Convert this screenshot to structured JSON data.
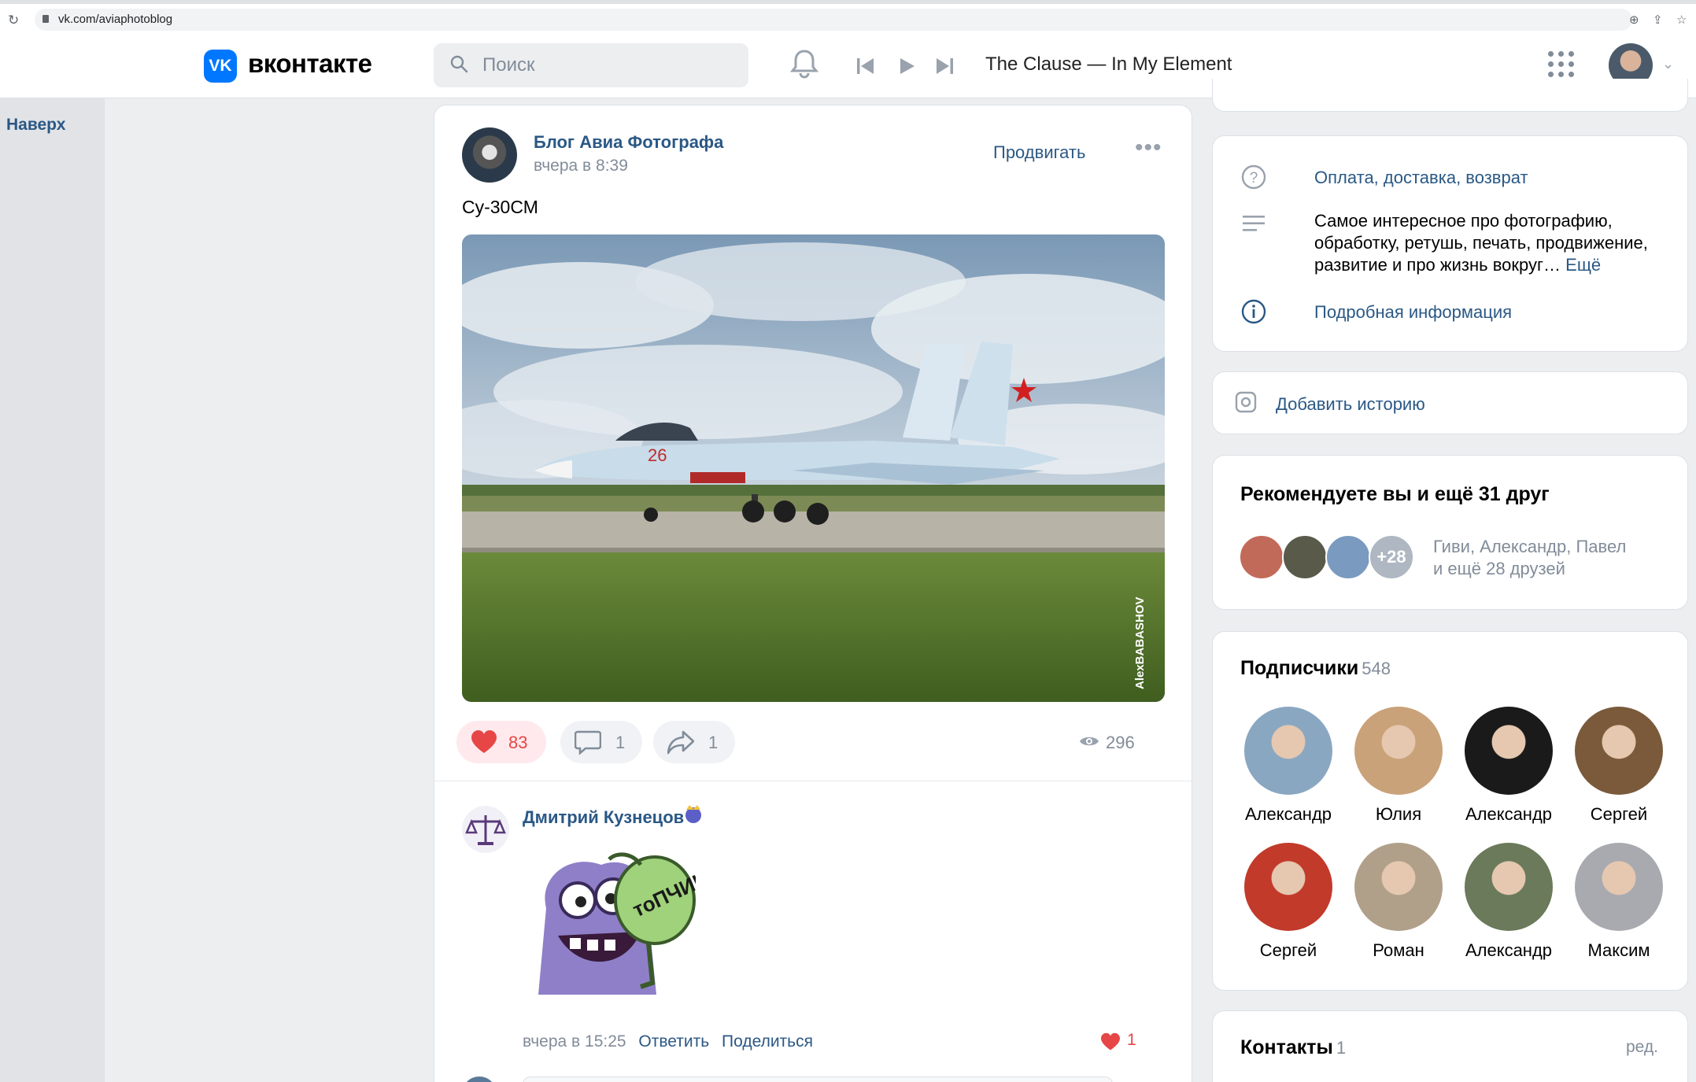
{
  "browser": {
    "url": "vk.com/aviaphotoblog"
  },
  "header": {
    "logo_text": "вконтакте",
    "logo_badge": "VK",
    "search_placeholder": "Поиск",
    "now_playing": "The Clause — In My Element"
  },
  "sidebar": {
    "up_label": "Наверх"
  },
  "post": {
    "author": "Блог Авиа Фотографа",
    "time": "вчера в 8:39",
    "promote_label": "Продвигать",
    "text": "Су-30СМ",
    "photo_watermark": "AlexBABASHOV",
    "likes": "83",
    "comments": "1",
    "shares": "1",
    "views": "296"
  },
  "comment": {
    "author": "Дмитрий Кузнецов",
    "sticker_text": "тоПЧИК",
    "time": "вчера в 15:25",
    "reply_label": "Ответить",
    "share_label": "Поделиться",
    "likes": "1"
  },
  "info": {
    "payment_link": "Оплата, доставка, возврат",
    "description": "Самое интересное про фотографию, обработку, ретушь, печать, продвижение, развитие и про жизнь вокруг…",
    "more_label": "Ещё",
    "details_link": "Подробная информация"
  },
  "story": {
    "add_label": "Добавить историю"
  },
  "recommend": {
    "title": "Рекомендуете вы и ещё 31 друг",
    "more_count": "+28",
    "names_line1": "Гиви, Александр, Павел",
    "names_line2": "и ещё 28 друзей"
  },
  "subscribers": {
    "title": "Подписчики",
    "count": "548",
    "people": [
      {
        "name": "Александр",
        "color": "#8aa7c2"
      },
      {
        "name": "Юлия",
        "color": "#c9a27a"
      },
      {
        "name": "Александр",
        "color": "#1a1a1a"
      },
      {
        "name": "Сергей",
        "color": "#7a5a3a"
      },
      {
        "name": "Сергей",
        "color": "#c23a2a"
      },
      {
        "name": "Роман",
        "color": "#b0a08a"
      },
      {
        "name": "Александр",
        "color": "#6a7a5a"
      },
      {
        "name": "Максим",
        "color": "#a8aab0"
      }
    ]
  },
  "contacts": {
    "title": "Контакты",
    "count": "1",
    "edit_label": "ред."
  }
}
